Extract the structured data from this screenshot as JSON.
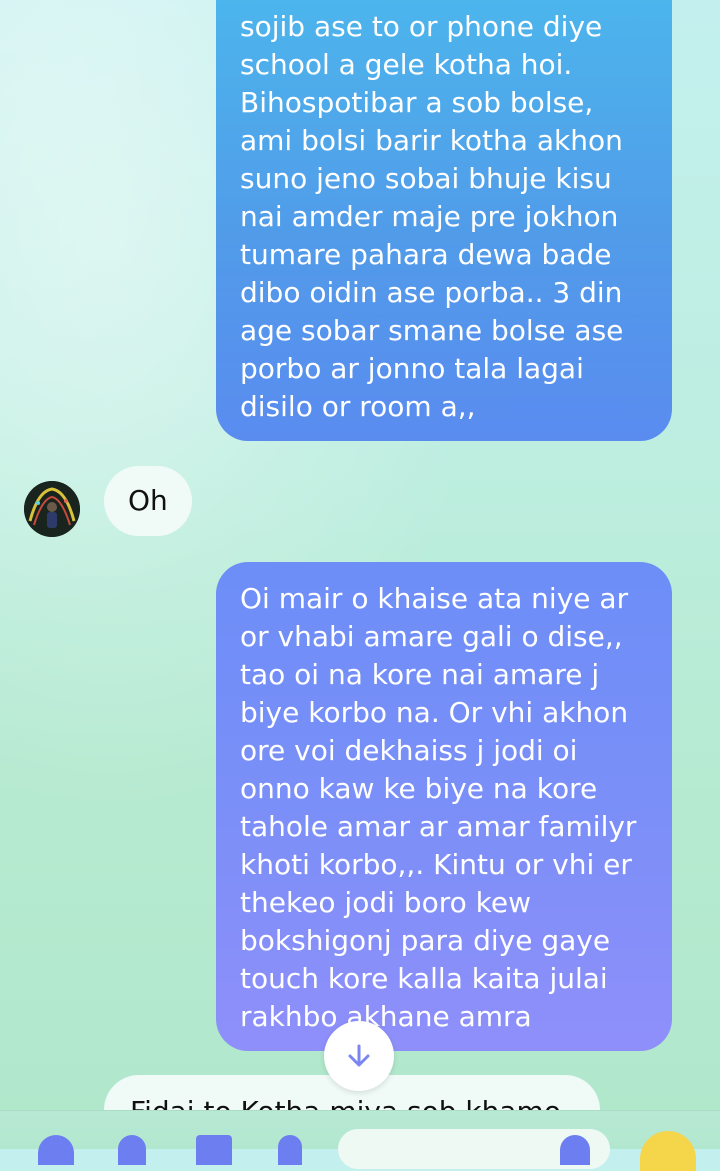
{
  "messages": [
    {
      "id": "msg1",
      "direction": "outgoing",
      "text": "sojib ase to or phone diye\nschool a gele kotha hoi.\nBihospotibar a  sob bolse,\nami bolsi barir kotha akhon\nsuno jeno sobai bhuje kisu\nnai amder maje pre jokhon\ntumare pahara dewa bade\ndibo oidin ase porba.. 3 din\nage sobar smane bolse ase\nporbo ar jonno tala lagai\ndisilo or room a,,"
    },
    {
      "id": "msg2",
      "direction": "incoming",
      "text": "Oh"
    },
    {
      "id": "msg3",
      "direction": "outgoing",
      "text": "Oi mair o khaise ata niye ar\nor vhabi amare gali o dise,,\ntao oi na kore nai amare j\nbiye korbo na.  Or vhi akhon\nore voi dekhaiss j jodi oi\nonno kaw ke biye na kore\ntahole amar ar amar familyr\nkhoti korbo,,.  Kintu or vhi er\nthekeo jodi boro kew\nbokshigonj para diye gaye\ntouch kore kalla kaita julai\nrakhbo akhane amra"
    },
    {
      "id": "msg4",
      "direction": "incoming",
      "text": "Fidai to Kotha miya sob khamo"
    }
  ],
  "icons": {
    "scroll_down": "arrow-down-icon",
    "avatar": "contact-avatar",
    "composer_left": "composer-action-icons",
    "emoji": "emoji-icon"
  },
  "colors": {
    "outgoing_top": "#4cb6ec",
    "outgoing_bottom": "#8f8ffa",
    "incoming_bg": "#f0fbf8",
    "accent": "#6c7ef0"
  }
}
